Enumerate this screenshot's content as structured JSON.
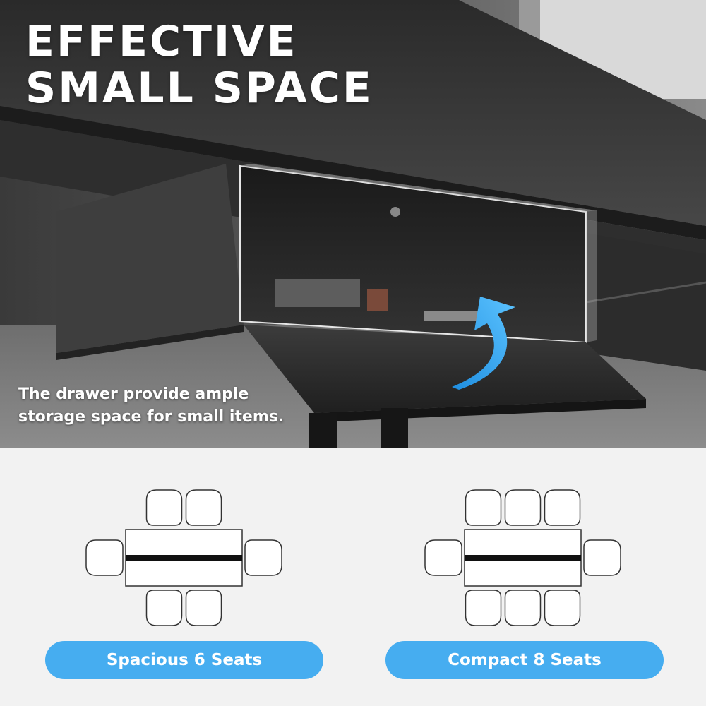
{
  "headline": {
    "line1": "EFFECTIVE",
    "line2": "SMALL SPACE"
  },
  "caption": {
    "line1": "The drawer provide ample",
    "line2": "storage space for small items."
  },
  "layouts": [
    {
      "label": "Spacious 6 Seats",
      "top_chairs": 2,
      "bottom_chairs": 2,
      "side_chairs": 2
    },
    {
      "label": "Compact 8 Seats",
      "top_chairs": 3,
      "bottom_chairs": 3,
      "side_chairs": 2
    }
  ],
  "colors": {
    "accent": "#46adf0",
    "arrow": "#2f9be6"
  }
}
